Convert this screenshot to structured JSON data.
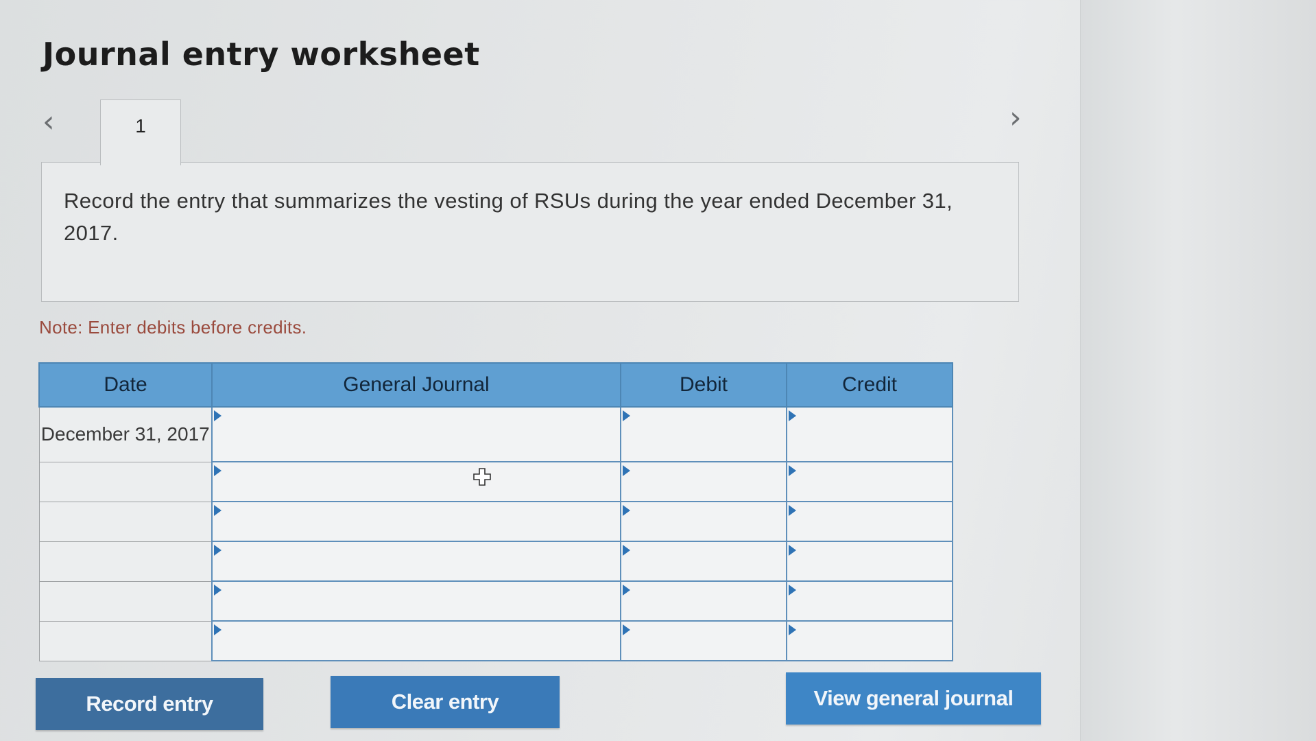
{
  "title": "Journal entry worksheet",
  "nav": {
    "prev_icon": "chevron-left-icon",
    "next_icon": "chevron-right-icon",
    "prev_glyph": "‹",
    "next_glyph": "›"
  },
  "tabs": [
    {
      "label": "1",
      "active": true
    }
  ],
  "prompt": "Record the entry that summarizes the vesting of RSUs during the year ended December 31, 2017.",
  "note": "Note: Enter debits before credits.",
  "table": {
    "headers": {
      "date": "Date",
      "journal": "General Journal",
      "debit": "Debit",
      "credit": "Credit"
    },
    "rows": [
      {
        "date": "December 31, 2017",
        "account": "",
        "debit": "",
        "credit": ""
      },
      {
        "date": "",
        "account": "",
        "debit": "",
        "credit": ""
      },
      {
        "date": "",
        "account": "",
        "debit": "",
        "credit": ""
      },
      {
        "date": "",
        "account": "",
        "debit": "",
        "credit": ""
      },
      {
        "date": "",
        "account": "",
        "debit": "",
        "credit": ""
      },
      {
        "date": "",
        "account": "",
        "debit": "",
        "credit": ""
      }
    ]
  },
  "buttons": {
    "record": "Record entry",
    "clear": "Clear entry",
    "view": "View general journal"
  },
  "colors": {
    "header_blue": "#5f9fd2",
    "button_blue": "#3a7ab8",
    "note_red": "#9a4a3d"
  }
}
